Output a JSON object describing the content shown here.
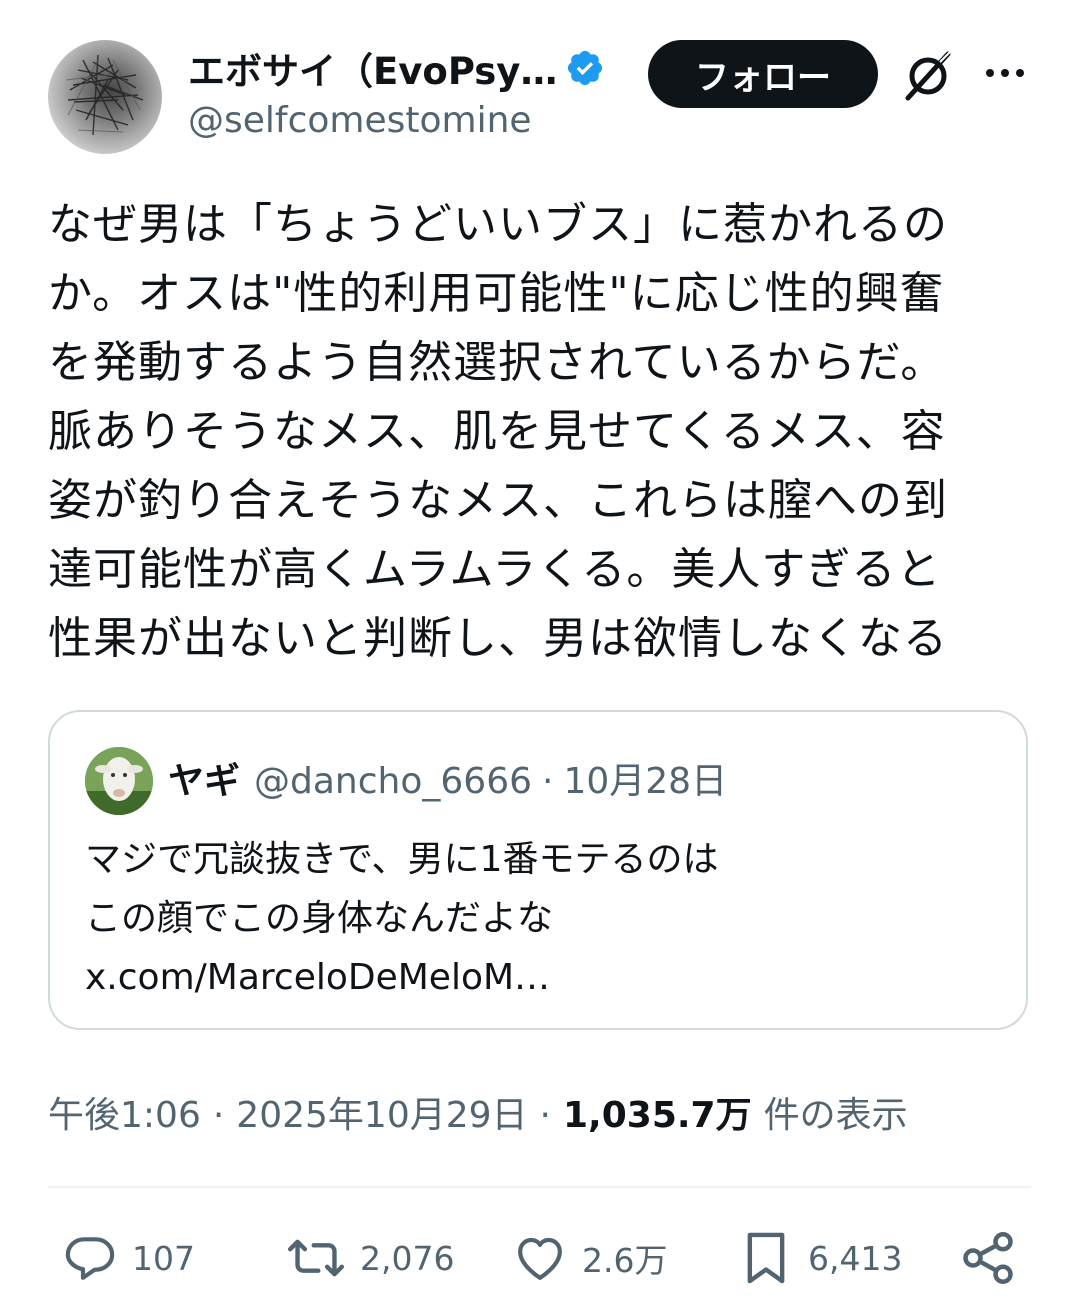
{
  "author": {
    "display_name": "エボサイ（EvoPsy…",
    "handle": "@selfcomestomine",
    "verified": true
  },
  "buttons": {
    "follow": "フォロー"
  },
  "tweet": {
    "lines": [
      "なぜ男は「ちょうどいいブス」に惹かれるの",
      "か。オスは\"性的利用可能性\"に応じ性的興奮",
      "を発動するよう自然選択されているからだ。",
      "脈ありそうなメス、肌を見せてくるメス、容",
      "姿が釣り合えそうなメス、これらは膣への到",
      "達可能性が高くムラムラくる。美人すぎると",
      "性果が出ないと判断し、男は欲情しなくなる"
    ]
  },
  "quote": {
    "display_name": "ヤギ",
    "handle": "@dancho_6666",
    "separator": "·",
    "date": "10月28日",
    "lines": [
      "マジで冗談抜きで、男に1番モテるのは",
      "この顔でこの身体なんだよな",
      "x.com/MarceloDeMeloM…"
    ]
  },
  "meta": {
    "time": "午後1:06",
    "separator": "·",
    "date": "2025年10月29日",
    "views": "1,035.7万",
    "views_label": "件の表示"
  },
  "actions": {
    "replies": "107",
    "reposts": "2,076",
    "likes": "2.6万",
    "bookmarks": "6,413"
  },
  "colors": {
    "text": "#0f1419",
    "secondary": "#536471",
    "verified": "#1d9bf0",
    "border": "#cfd9de"
  },
  "icons": [
    "verified-badge-icon",
    "grok-icon",
    "more-icon",
    "reply-icon",
    "repost-icon",
    "like-icon",
    "bookmark-icon",
    "share-icon"
  ]
}
